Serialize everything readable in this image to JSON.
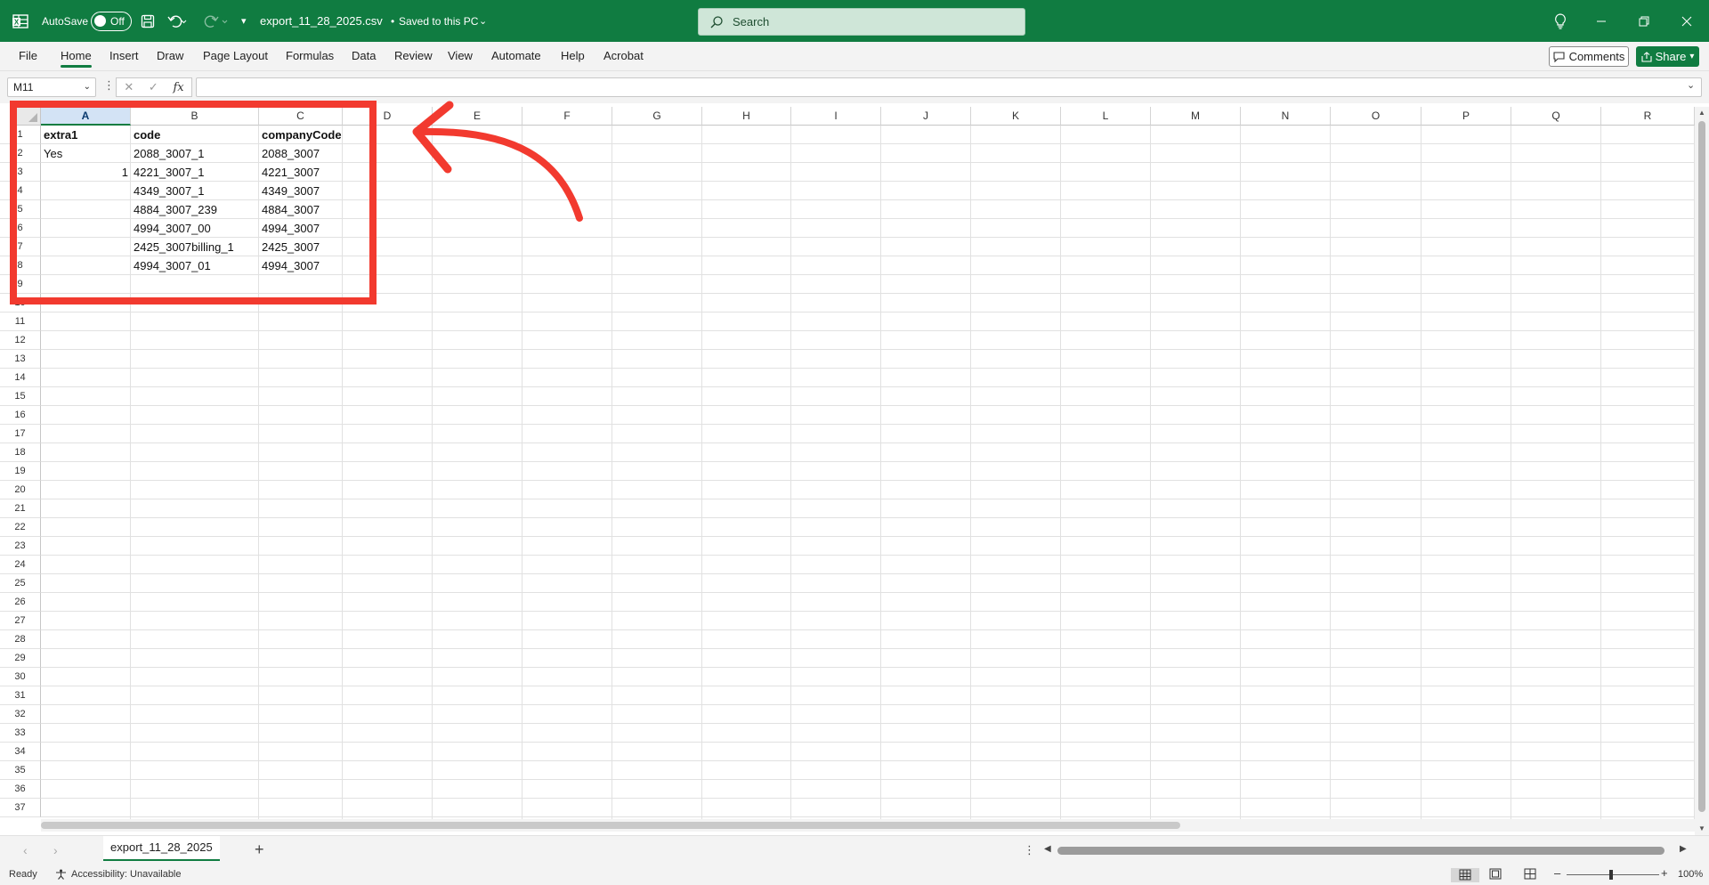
{
  "titlebar": {
    "autosave_label": "AutoSave",
    "autosave_state": "Off",
    "filename": "export_11_28_2025.csv",
    "save_status": "Saved to this PC",
    "search_placeholder": "Search"
  },
  "menu": [
    "File",
    "Home",
    "Insert",
    "Draw",
    "Page Layout",
    "Formulas",
    "Data",
    "Review",
    "View",
    "Automate",
    "Help",
    "Acrobat"
  ],
  "actions": {
    "comments": "Comments",
    "share": "Share"
  },
  "formula_bar": {
    "name_box": "M11",
    "fx": "fx",
    "formula": ""
  },
  "columns": [
    "A",
    "B",
    "C",
    "D",
    "E",
    "F",
    "G",
    "H",
    "I",
    "J",
    "K",
    "L",
    "M",
    "N",
    "O",
    "P",
    "Q",
    "R"
  ],
  "selected_column": "A",
  "rows": [
    "1",
    "2",
    "3",
    "4",
    "5",
    "6",
    "7",
    "8",
    "9",
    "10",
    "11",
    "12",
    "13",
    "14",
    "15",
    "16",
    "17",
    "18",
    "19",
    "20",
    "21",
    "22",
    "23",
    "24",
    "25",
    "26",
    "27",
    "28",
    "29",
    "30",
    "31",
    "32",
    "33",
    "34",
    "35",
    "36",
    "37"
  ],
  "cells": [
    {
      "row": 1,
      "col": "A",
      "value": "extra1",
      "bold": true
    },
    {
      "row": 1,
      "col": "B",
      "value": "code",
      "bold": true
    },
    {
      "row": 1,
      "col": "C",
      "value": "companyCode",
      "bold": true
    },
    {
      "row": 2,
      "col": "A",
      "value": "Yes"
    },
    {
      "row": 2,
      "col": "B",
      "value": "2088_3007_1"
    },
    {
      "row": 2,
      "col": "C",
      "value": "2088_3007"
    },
    {
      "row": 3,
      "col": "A",
      "value": "1",
      "num": true
    },
    {
      "row": 3,
      "col": "B",
      "value": "4221_3007_1"
    },
    {
      "row": 3,
      "col": "C",
      "value": "4221_3007"
    },
    {
      "row": 4,
      "col": "B",
      "value": "4349_3007_1"
    },
    {
      "row": 4,
      "col": "C",
      "value": "4349_3007"
    },
    {
      "row": 5,
      "col": "B",
      "value": "4884_3007_239"
    },
    {
      "row": 5,
      "col": "C",
      "value": "4884_3007"
    },
    {
      "row": 6,
      "col": "B",
      "value": "4994_3007_00"
    },
    {
      "row": 6,
      "col": "C",
      "value": "4994_3007"
    },
    {
      "row": 7,
      "col": "B",
      "value": "2425_3007billing_1"
    },
    {
      "row": 7,
      "col": "C",
      "value": "2425_3007"
    },
    {
      "row": 8,
      "col": "B",
      "value": "4994_3007_01"
    },
    {
      "row": 8,
      "col": "C",
      "value": "4994_3007"
    }
  ],
  "sheet_tab": "export_11_28_2025",
  "status": {
    "ready": "Ready",
    "accessibility": "Accessibility: Unavailable",
    "zoom": "100%"
  },
  "colors": {
    "brand": "#107c41",
    "annotation": "#f23a2f"
  }
}
